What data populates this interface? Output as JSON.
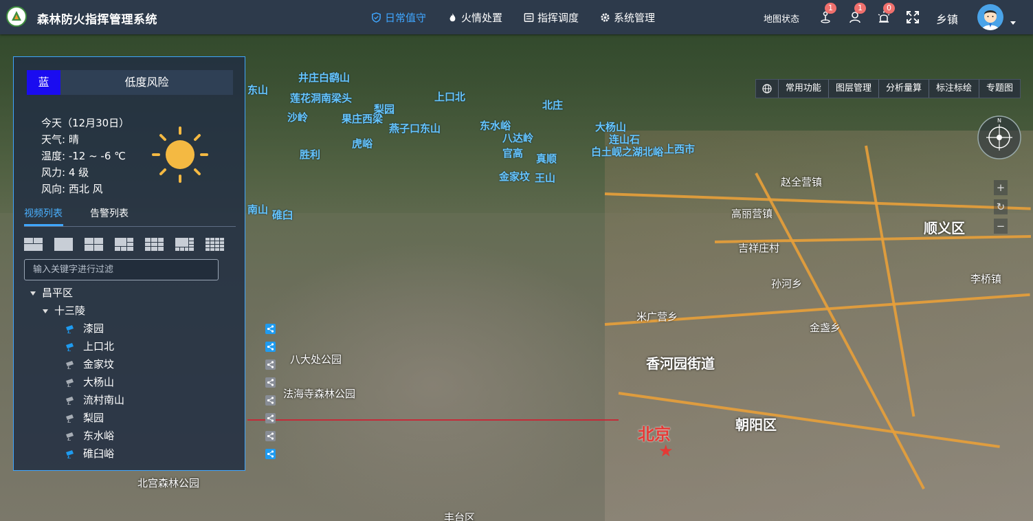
{
  "app": {
    "title": "森林防火指挥管理系统",
    "brand_color": "#2d3a4b",
    "accent": "#3fa6ff"
  },
  "nav": [
    {
      "label": "日常值守",
      "icon": "shield-icon",
      "active": true
    },
    {
      "label": "火情处置",
      "icon": "flame-icon",
      "active": false
    },
    {
      "label": "指挥调度",
      "icon": "command-icon",
      "active": false
    },
    {
      "label": "系统管理",
      "icon": "gear-icon",
      "active": false
    }
  ],
  "header": {
    "map_status": "地图状态",
    "alerts": [
      {
        "icon": "person-marker-icon",
        "count": "1"
      },
      {
        "icon": "user-icon",
        "count": "1"
      },
      {
        "icon": "alarm-light-icon",
        "count": "0"
      }
    ],
    "fullscreen_icon": "fullscreen-icon",
    "township": "乡镇"
  },
  "map_toolbar": {
    "items": [
      "常用功能",
      "图层管理",
      "分析量算",
      "标注标绘",
      "专题图"
    ],
    "globe_icon": "globe-icon"
  },
  "map_zoom": {
    "in": "+",
    "reset": "↻",
    "out": "−"
  },
  "risk": {
    "level": "蓝",
    "level_color": "#1a0cf0",
    "text": "低度风险"
  },
  "weather": {
    "date": "今天（12月30日）",
    "condition": "天气:  晴",
    "temperature": "温度:  -12 ~ -6 ℃",
    "wind_force": "风力:  4 级",
    "wind_direction": "风向:  西北 风",
    "icon": "sun-icon"
  },
  "panel_tabs": [
    {
      "label": "视频列表",
      "active": true
    },
    {
      "label": "告警列表",
      "active": false
    }
  ],
  "layouts": [
    "layout-1x2-icon",
    "layout-1-icon",
    "layout-2x2-icon",
    "layout-1plus5-icon",
    "layout-3x3-icon",
    "layout-1plus7-icon",
    "layout-4x4-icon"
  ],
  "filter": {
    "placeholder": "输入关键字进行过滤",
    "value": ""
  },
  "tree": {
    "district": "昌平区",
    "group": "十三陵",
    "cameras": [
      {
        "name": "漆园",
        "online": true
      },
      {
        "name": "上口北",
        "online": true
      },
      {
        "name": "金家坟",
        "online": false
      },
      {
        "name": "大杨山",
        "online": false
      },
      {
        "name": "流村南山",
        "online": false
      },
      {
        "name": "梨园",
        "online": false
      },
      {
        "name": "东水峪",
        "online": false
      },
      {
        "name": "碓臼峪",
        "online": true
      }
    ]
  },
  "map_labels": {
    "camera_points": [
      "井庄白鹞山",
      "东山",
      "莲花洞南梁头",
      "上口北",
      "沙岭",
      "果庄西梁",
      "梨园",
      "东水峪",
      "北庄",
      "大杨山",
      "虎峪",
      "燕子口东山",
      "八达岭",
      "官高",
      "连山石",
      "白土岘之湖北峪",
      "上西市",
      "金家坟",
      "王山",
      "胜利",
      "真顺",
      "碓臼",
      "南山"
    ],
    "towns": [
      "赵全营镇",
      "高丽营镇",
      "吉祥庄村",
      "顺义区",
      "孙河乡",
      "李桥镇",
      "米广营乡",
      "金盏乡",
      "香河园街道",
      "朝阳区",
      "北宫森林公园",
      "法海寺森林公园",
      "八大处公园",
      "丰台区"
    ],
    "capital": "北京"
  }
}
